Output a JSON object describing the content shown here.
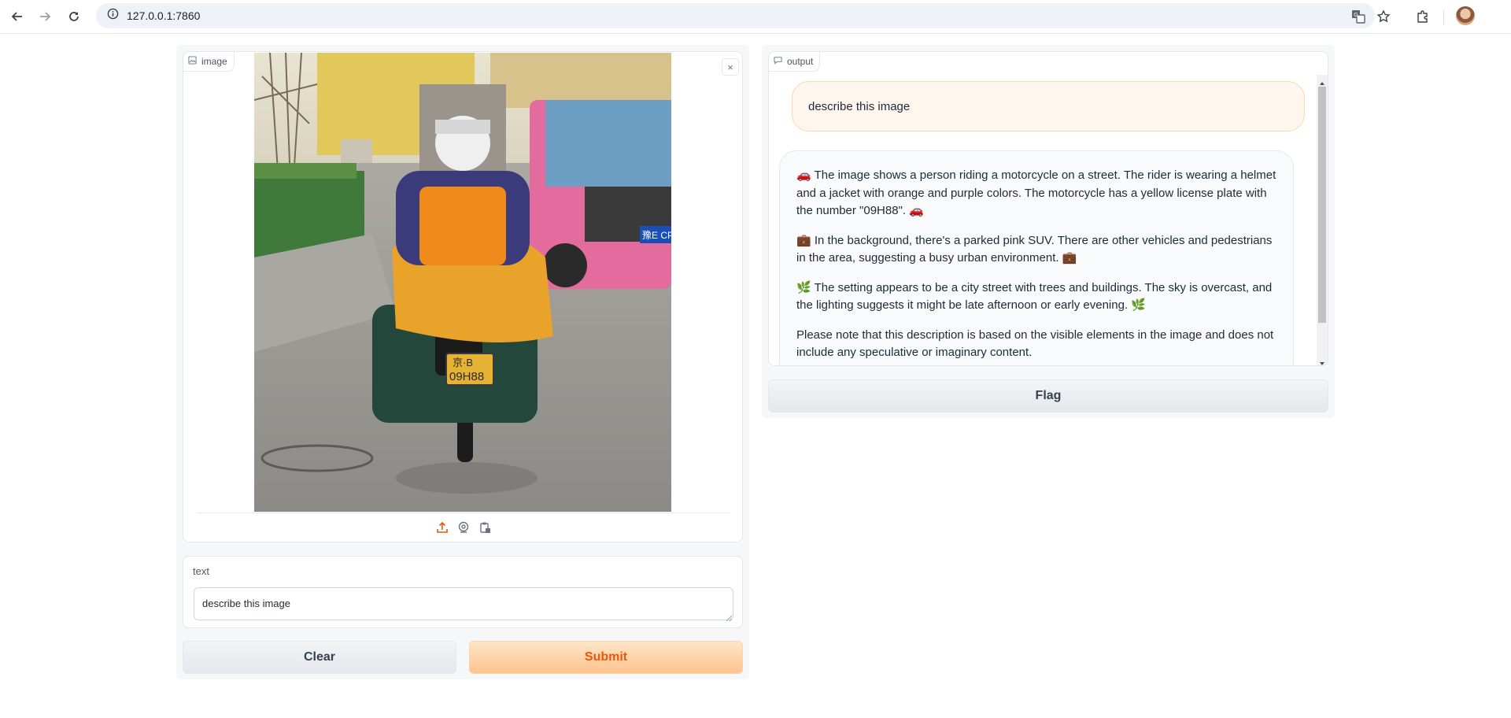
{
  "browser": {
    "url": "127.0.0.1:7860"
  },
  "image_block": {
    "label": "image",
    "close_symbol": "×"
  },
  "text_block": {
    "label": "text",
    "value": "describe this image"
  },
  "buttons": {
    "clear": "Clear",
    "submit": "Submit",
    "flag": "Flag"
  },
  "output_block": {
    "label": "output",
    "user_message": "describe this image",
    "bot_paragraphs": [
      "🚗 The image shows a person riding a motorcycle on a street. The rider is wearing a helmet and a jacket with orange and purple colors. The motorcycle has a yellow license plate with the number \"09H88\". 🚗",
      "💼 In the background, there's a parked pink SUV. There are other vehicles and pedestrians in the area, suggesting a busy urban environment. 💼",
      "🌿 The setting appears to be a city street with trees and buildings. The sky is overcast, and the lighting suggests it might be late afternoon or early evening. 🌿",
      "Please note that this description is based on the visible elements in the image and does not include any speculative or imaginary content."
    ]
  },
  "photo": {
    "plate_top": "京·B",
    "plate_bottom": "09H88",
    "suv_plate": "豫E CPS"
  },
  "colors": {
    "accent": "#ea580c",
    "primary_button": "#fdc38e",
    "user_bubble": "#fff7ed"
  }
}
